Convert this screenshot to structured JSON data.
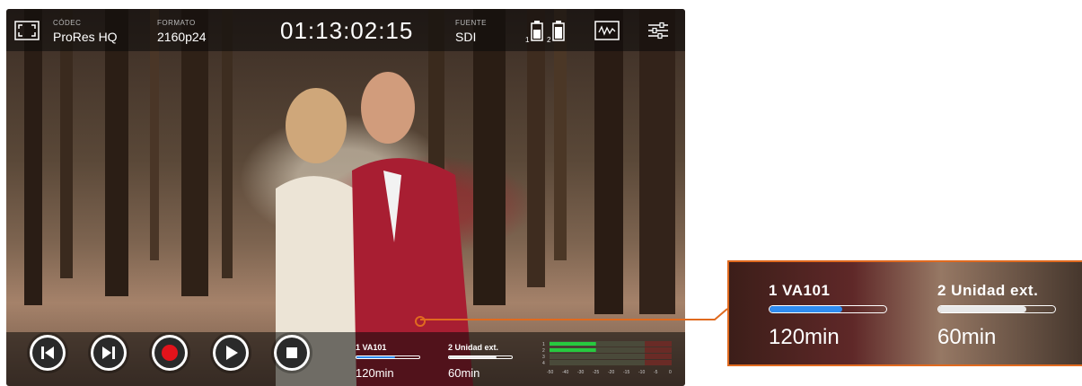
{
  "topbar": {
    "codec_label": "CÓDEC",
    "codec_value": "ProRes HQ",
    "format_label": "FORMATO",
    "format_value": "2160p24",
    "timecode": "01:13:02:15",
    "source_label": "FUENTE",
    "source_value": "SDI",
    "battery1_index": "1",
    "battery2_index": "2"
  },
  "icons": {
    "fullscreen": "fullscreen-icon",
    "battery": "battery-icon",
    "scope": "waveform-icon",
    "settings": "settings-sliders-icon",
    "skip_back": "skip-back-icon",
    "skip_forward": "skip-forward-icon",
    "record": "record-icon",
    "play": "play-icon",
    "stop": "stop-icon"
  },
  "media": [
    {
      "label": "1  VA101",
      "time": "120min",
      "fill": 0.62,
      "color": "#2f8cf0"
    },
    {
      "label": "2  Unidad ext.",
      "time": "60min",
      "fill": 0.75,
      "color": "#e8e8e8"
    }
  ],
  "meters": {
    "channels": [
      "1",
      "2",
      "3",
      "4"
    ],
    "levels": [
      0.38,
      0.38,
      0.0,
      0.0
    ],
    "scale": [
      "-50",
      "-40",
      "-30",
      "-25",
      "-20",
      "-15",
      "-10",
      "-5",
      "0"
    ]
  },
  "callout": {
    "slot1_label": "1  VA101",
    "slot1_time": "120min",
    "slot2_label": "2  Unidad ext.",
    "slot2_time": "60min"
  },
  "colors": {
    "accent_orange": "#e06a1f",
    "record_red": "#e3131b",
    "slot1_blue": "#2f8cf0"
  }
}
